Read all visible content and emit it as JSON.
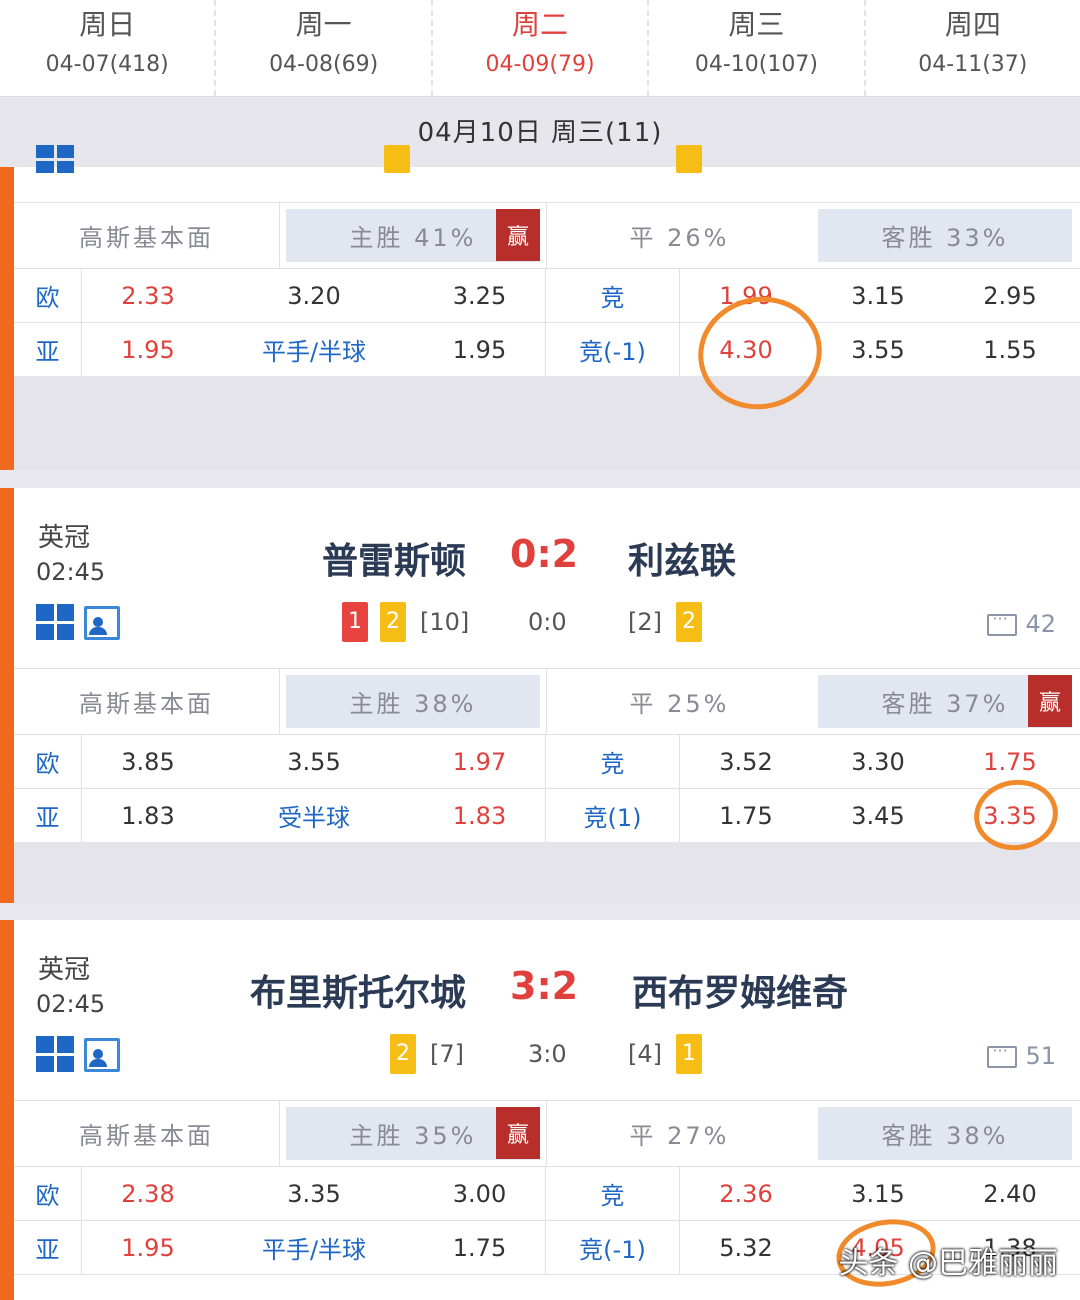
{
  "days": [
    {
      "weekday": "周日",
      "date": "04-07(418)"
    },
    {
      "weekday": "周一",
      "date": "04-08(69)"
    },
    {
      "weekday": "周二",
      "date": "04-09(79)",
      "active": true
    },
    {
      "weekday": "周三",
      "date": "04-10(107)"
    },
    {
      "weekday": "周四",
      "date": "04-11(37)"
    }
  ],
  "date_header": "04月10日 周三(11)",
  "matches": [
    {
      "header": {
        "basic": "高斯基本面",
        "home": "主胜 41%",
        "draw": "平 26%",
        "away": "客胜 33%",
        "win_badge": "赢",
        "win_side": "home"
      },
      "eu": {
        "label": "欧",
        "v1": "2.33",
        "v2": "3.20",
        "v3": "3.25",
        "j_label": "竞",
        "j1": "1.99",
        "j2": "3.15",
        "j3": "2.95"
      },
      "asia": {
        "label": "亚",
        "v1": "1.95",
        "handicap": "平手/半球",
        "v3": "1.95",
        "j_label": "竞(-1)",
        "j1": "4.30",
        "j2": "3.55",
        "j3": "1.55"
      }
    },
    {
      "league": "英冠",
      "time": "02:45",
      "home": "普雷斯顿",
      "score": "0:2",
      "away": "利兹联",
      "home_red": "1",
      "home_yellow": "2",
      "home_rank": "[10]",
      "halftime": "0:0",
      "away_rank": "[2]",
      "away_yellow": "2",
      "comments": "42",
      "header": {
        "basic": "高斯基本面",
        "home": "主胜 38%",
        "draw": "平 25%",
        "away": "客胜 37%",
        "win_badge": "赢",
        "win_side": "away"
      },
      "eu": {
        "label": "欧",
        "v1": "3.85",
        "v2": "3.55",
        "v3": "1.97",
        "j_label": "竞",
        "j1": "3.52",
        "j2": "3.30",
        "j3": "1.75"
      },
      "asia": {
        "label": "亚",
        "v1": "1.83",
        "handicap": "受半球",
        "v3": "1.83",
        "j_label": "竞(1)",
        "j1": "1.75",
        "j2": "3.45",
        "j3": "3.35"
      }
    },
    {
      "league": "英冠",
      "time": "02:45",
      "home": "布里斯托尔城",
      "score": "3:2",
      "away": "西布罗姆维奇",
      "home_yellow": "2",
      "home_rank": "[7]",
      "halftime": "3:0",
      "away_rank": "[4]",
      "away_yellow": "1",
      "comments": "51",
      "header": {
        "basic": "高斯基本面",
        "home": "主胜 35%",
        "draw": "平 27%",
        "away": "客胜 38%",
        "win_badge": "赢",
        "win_side": "home"
      },
      "eu": {
        "label": "欧",
        "v1": "2.38",
        "v2": "3.35",
        "v3": "3.00",
        "j_label": "竞",
        "j1": "2.36",
        "j2": "3.15",
        "j3": "2.40"
      },
      "asia": {
        "label": "亚",
        "v1": "1.95",
        "handicap": "平手/半球",
        "v3": "1.75",
        "j_label": "竞(-1)",
        "j1": "5.32",
        "j2": "4.05",
        "j3": "1.38"
      }
    }
  ],
  "watermark": "头条 @巴雅丽丽",
  "colors": {
    "accent": "#ef6a1f",
    "red": "#e0413c",
    "blue": "#1f67c4",
    "circle": "#f08a2a",
    "badge": "#b82e2a"
  }
}
